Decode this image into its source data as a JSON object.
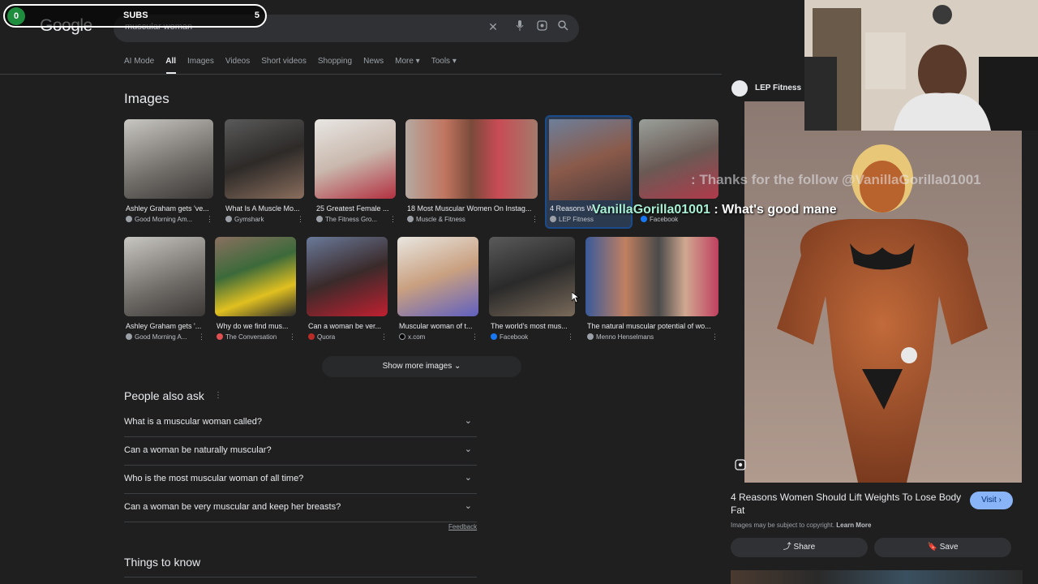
{
  "header": {
    "logo": "Google",
    "search_query": "muscular woman"
  },
  "subs_overlay": {
    "current": "0",
    "label": "SUBS",
    "goal": "5"
  },
  "tabs": [
    "AI Mode",
    "All",
    "Images",
    "Videos",
    "Short videos",
    "Shopping",
    "News",
    "More ▾",
    "Tools ▾"
  ],
  "images_section": {
    "title": "Images",
    "row1": [
      {
        "caption": "Ashley Graham gets 've...",
        "source": "Good Morning Am..."
      },
      {
        "caption": "What Is A Muscle Mo...",
        "source": "Gymshark"
      },
      {
        "caption": "25 Greatest Female ...",
        "source": "The Fitness Gro..."
      },
      {
        "caption": "18 Most Muscular Women On Instag...",
        "source": "Muscle & Fitness"
      },
      {
        "caption": "4 Reasons W...",
        "source": "LEP Fitness"
      },
      {
        "caption": "",
        "source": "Facebook"
      }
    ],
    "row2": [
      {
        "caption": "Ashley Graham gets '...",
        "source": "Good Morning A..."
      },
      {
        "caption": "Why do we find mus...",
        "source": "The Conversation"
      },
      {
        "caption": "Can a woman be ver...",
        "source": "Quora"
      },
      {
        "caption": "Muscular woman of t...",
        "source": "x.com"
      },
      {
        "caption": "The world's most mus...",
        "source": "Facebook"
      },
      {
        "caption": "The natural muscular potential of wo...",
        "source": "Menno Henselmans"
      }
    ],
    "show_more": "Show more images"
  },
  "people_also_ask": {
    "title": "People also ask",
    "questions": [
      "What is a muscular woman called?",
      "Can a woman be naturally muscular?",
      "Who is the most muscular woman of all time?",
      "Can a woman be very muscular and keep her breasts?"
    ],
    "feedback": "Feedback"
  },
  "things_to_know": "Things to know",
  "side_panel": {
    "site_name": "LEP Fitness",
    "title": "4 Reasons Women Should Lift Weights To Lose Body Fat",
    "visit": "Visit ›",
    "copyright_note": "Images may be subject to copyright.",
    "learn_more": "Learn More",
    "share": "Share",
    "save": "Save"
  },
  "stream_overlay": {
    "follow_alert": ": Thanks for the follow @VanillaGorilla01001",
    "chat_user": "VanillaGorilla01001",
    "chat_message": " : What's good mane"
  },
  "colors": {
    "background": "#1f1f1f",
    "accent_blue": "#8ab4f8",
    "subs_green": "#1e8e3e"
  }
}
